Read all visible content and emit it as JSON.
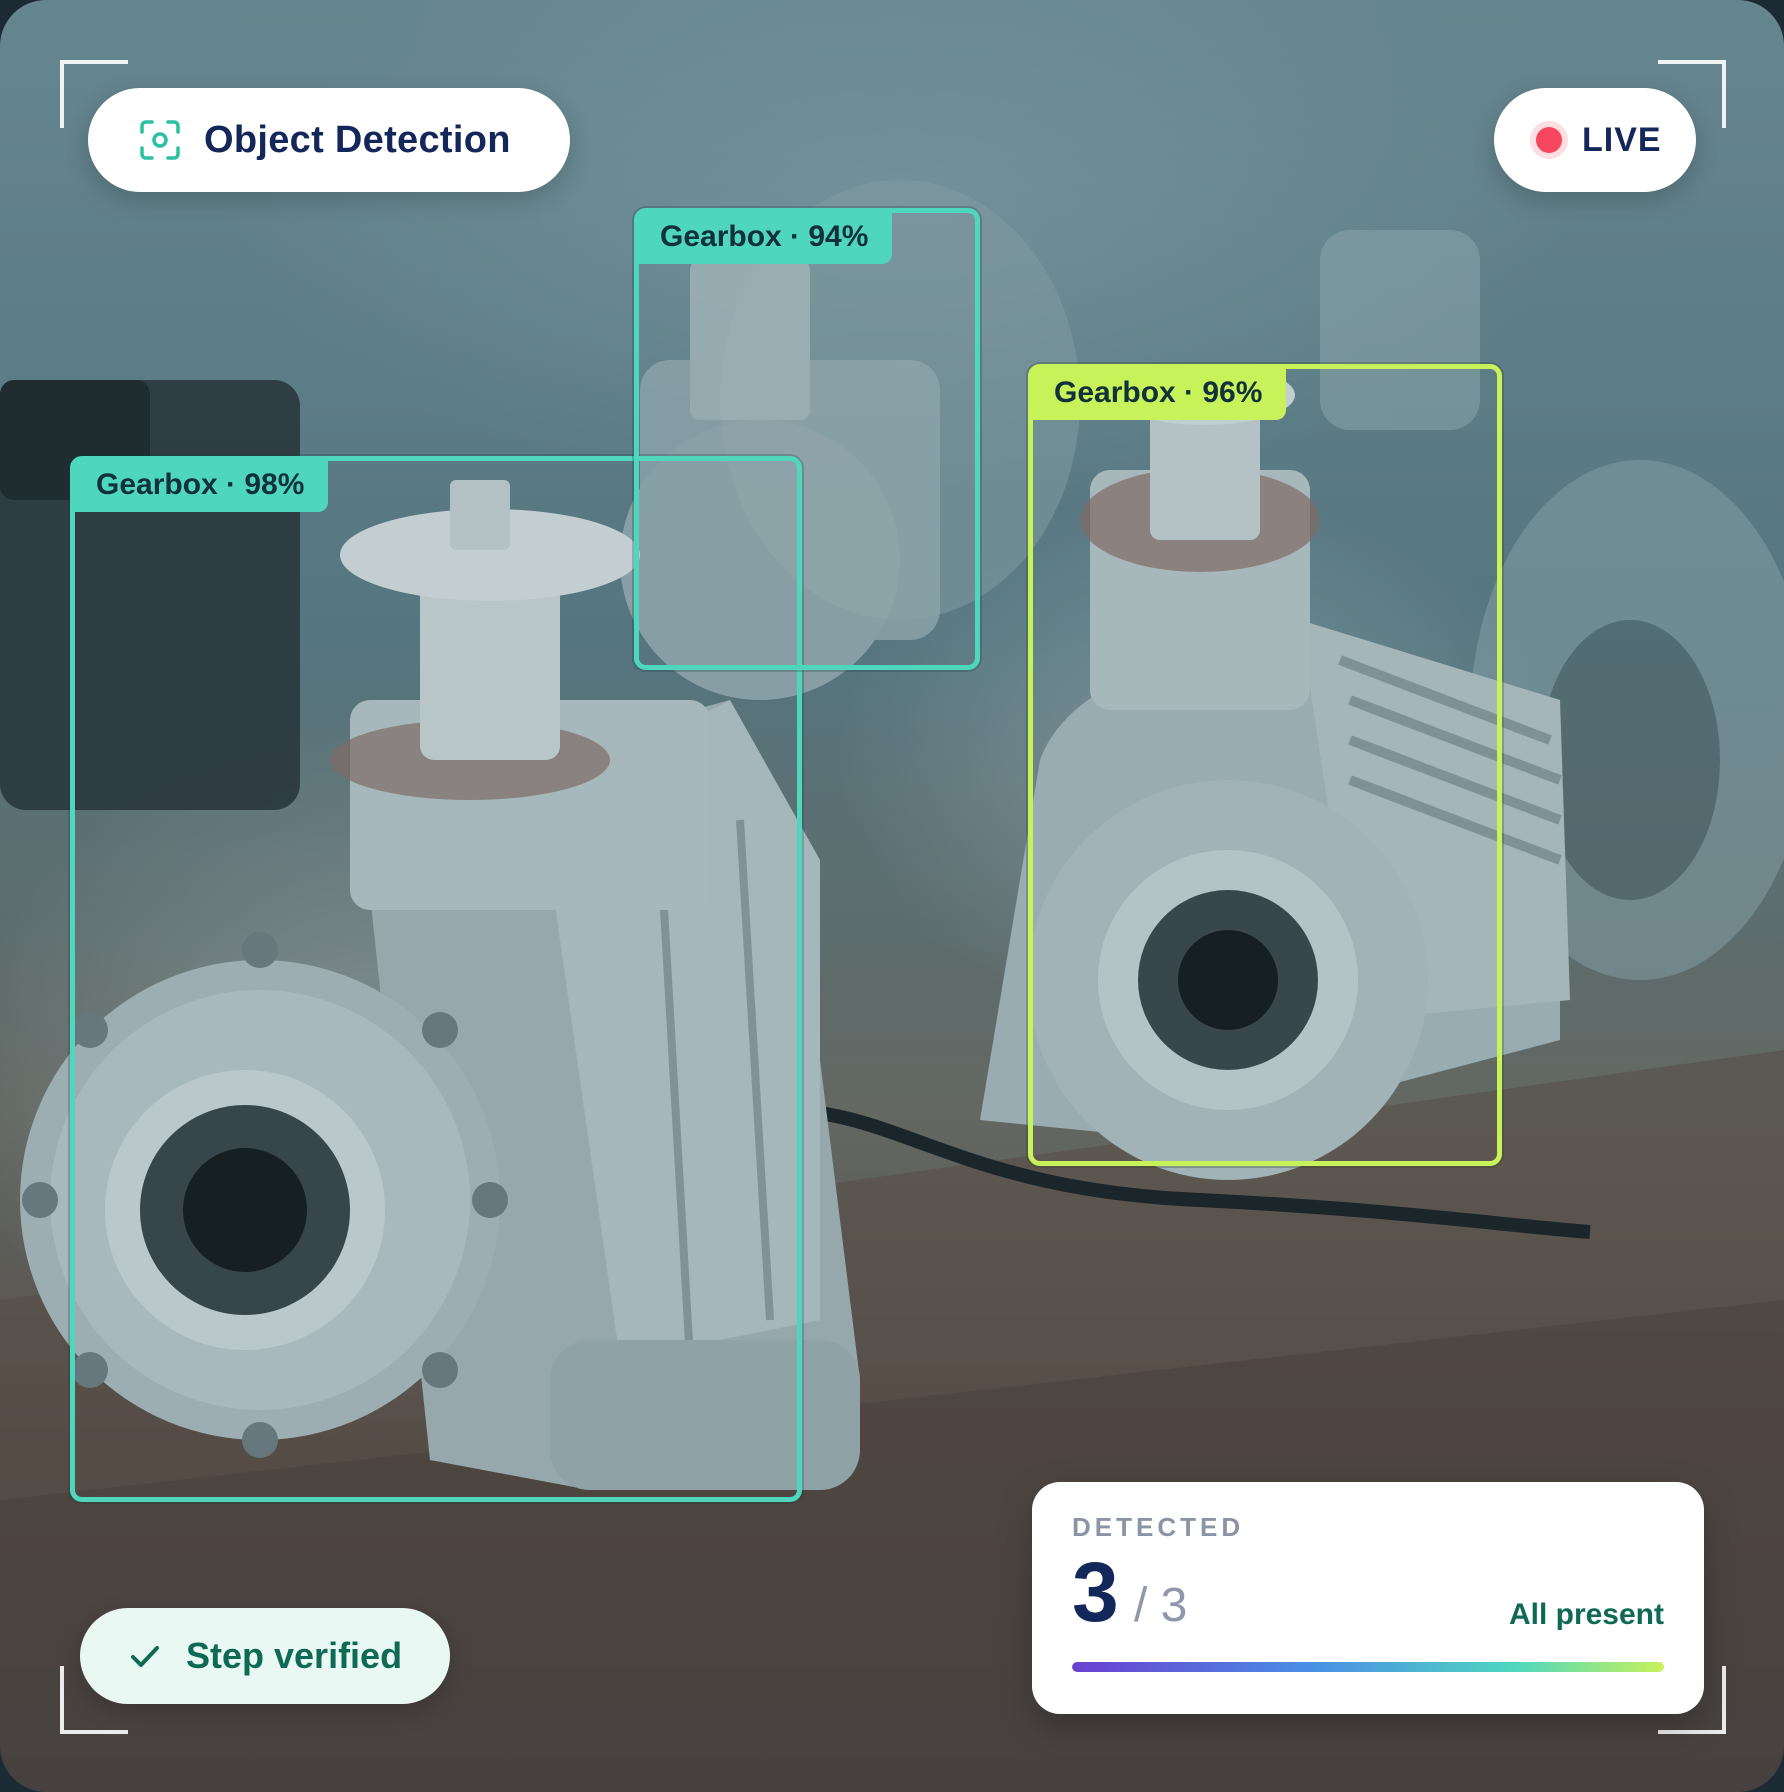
{
  "header": {
    "title": "Object Detection",
    "title_icon": "scan-camera-icon",
    "live_label": "LIVE",
    "live_color": "#f6475f"
  },
  "detections": [
    {
      "label": "Gearbox · 98%",
      "color": "#4fd7be"
    },
    {
      "label": "Gearbox · 94%",
      "color": "#4fd7be"
    },
    {
      "label": "Gearbox · 96%",
      "color": "#c8f25a"
    }
  ],
  "status": {
    "verified_label": "Step verified",
    "verified_icon": "check-icon"
  },
  "summary": {
    "caption": "DETECTED",
    "count": "3",
    "total": "/ 3",
    "status_text": "All present",
    "progress_fraction": 1.0
  },
  "colors": {
    "navy": "#13275a",
    "teal": "#4fd7be",
    "lime": "#c8f25a",
    "green_text": "#0f6a55"
  }
}
